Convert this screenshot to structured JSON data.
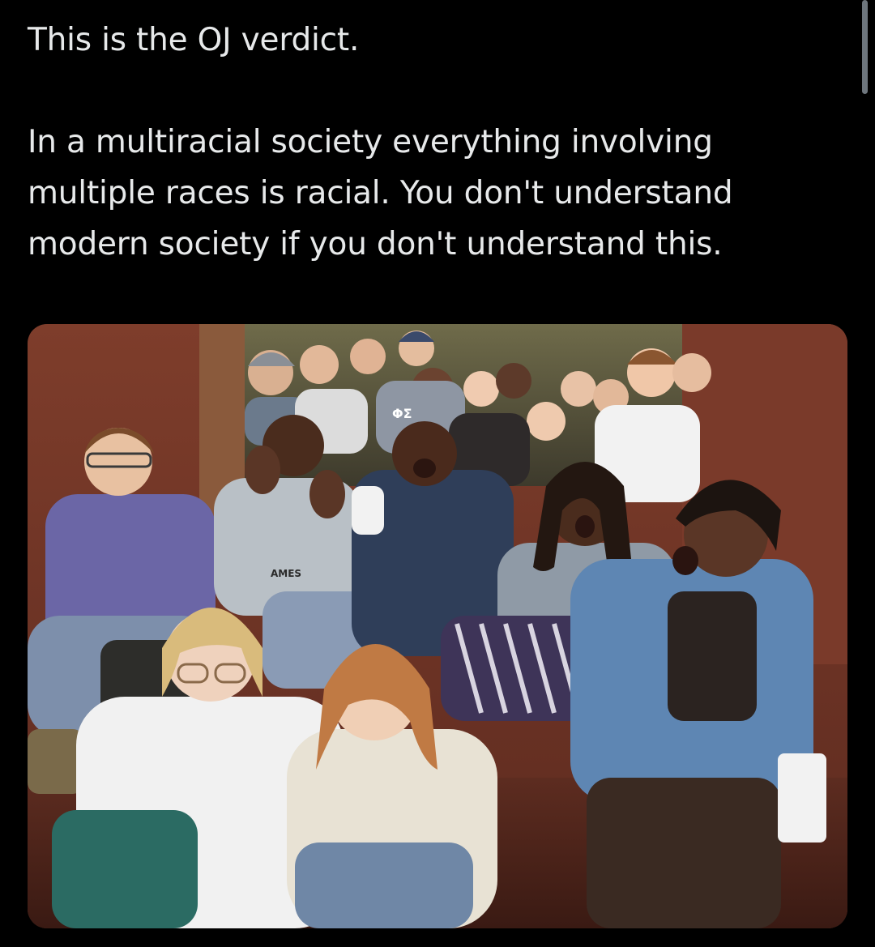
{
  "post": {
    "line_1": "This is the OJ verdict.",
    "paragraph_2": "In a multiracial society everything involving multiple races is racial. You don't understand modern society if you don't understand this."
  },
  "media": {
    "type": "photo",
    "printed_text": [
      "ΦΣ",
      "AMES"
    ],
    "colors": {
      "wall": "#7a3a2a",
      "carpet": "#5a2a1e",
      "background": "#000000",
      "text": "#e7e9ea"
    }
  }
}
